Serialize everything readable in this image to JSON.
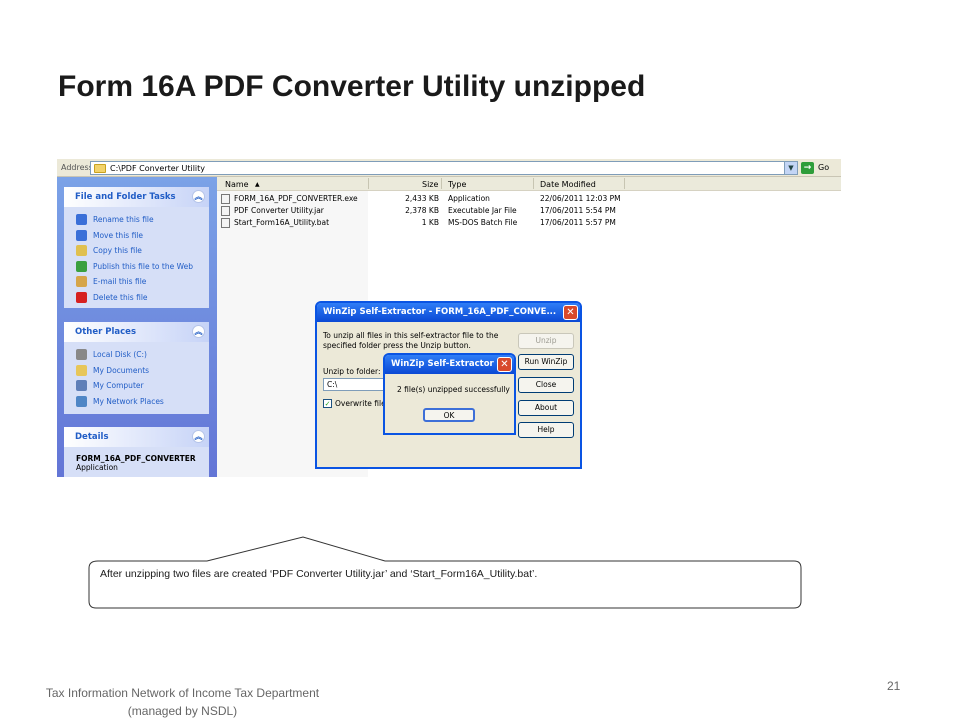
{
  "slide": {
    "title": "Form 16A PDF Converter Utility unzipped",
    "callout_text": "After unzipping two files are created ‘PDF Converter Utility.jar’ and ‘Start_Form16A_Utility.bat’.",
    "footer_line1": "Tax Information Network of Income Tax Department",
    "footer_line2": "(managed by NSDL)",
    "page_number": "21"
  },
  "explorer": {
    "address_label": "Address",
    "address_value": "C:\\PDF Converter Utility",
    "go_label": "Go",
    "file_tasks": {
      "title": "File and Folder Tasks",
      "items": [
        {
          "label": "Rename this file",
          "icon": "rename-icon",
          "color": "#3a6fd8"
        },
        {
          "label": "Move this file",
          "icon": "move-icon",
          "color": "#3a6fd8"
        },
        {
          "label": "Copy this file",
          "icon": "copy-icon",
          "color": "#e0c050"
        },
        {
          "label": "Publish this file to the Web",
          "icon": "globe-icon",
          "color": "#3aa040"
        },
        {
          "label": "E-mail this file",
          "icon": "email-icon",
          "color": "#d6a54a"
        },
        {
          "label": "Delete this file",
          "icon": "delete-icon",
          "color": "#d62020"
        }
      ]
    },
    "other_places": {
      "title": "Other Places",
      "items": [
        {
          "label": "Local Disk (C:)",
          "icon": "disk-icon",
          "color": "#888888"
        },
        {
          "label": "My Documents",
          "icon": "folder-icon",
          "color": "#e7c65a"
        },
        {
          "label": "My Computer",
          "icon": "computer-icon",
          "color": "#5f7fb8"
        },
        {
          "label": "My Network Places",
          "icon": "network-icon",
          "color": "#4f86c6"
        }
      ]
    },
    "details": {
      "title": "Details",
      "name": "FORM_16A_PDF_CONVERTER",
      "type": "Application"
    },
    "columns": [
      "Name",
      "Size",
      "Type",
      "Date Modified"
    ],
    "files": [
      {
        "name": "FORM_16A_PDF_CONVERTER.exe",
        "size": "2,433 KB",
        "type": "Application",
        "date": "22/06/2011 12:03 PM"
      },
      {
        "name": "PDF Converter Utility.jar",
        "size": "2,378 KB",
        "type": "Executable Jar File",
        "date": "17/06/2011 5:54 PM"
      },
      {
        "name": "Start_Form16A_Utility.bat",
        "size": "1 KB",
        "type": "MS-DOS Batch File",
        "date": "17/06/2011 5:57 PM"
      }
    ]
  },
  "winzip_dialog": {
    "title": "WinZip Self-Extractor - FORM_16A_PDF_CONVE...",
    "instructions_line1": "To unzip all files in this self-extractor file to the",
    "instructions_line2": "specified folder press the Unzip button.",
    "unzip_to_label": "Unzip to folder:",
    "unzip_to_value": "C:\\",
    "overwrite_label": "Overwrite files",
    "buttons": {
      "unzip": "Unzip",
      "run_winzip": "Run WinZip",
      "close": "Close",
      "about": "About",
      "help": "Help"
    }
  },
  "success_dialog": {
    "title": "WinZip Self-Extractor",
    "message": "2 file(s) unzipped successfully",
    "ok_label": "OK"
  }
}
